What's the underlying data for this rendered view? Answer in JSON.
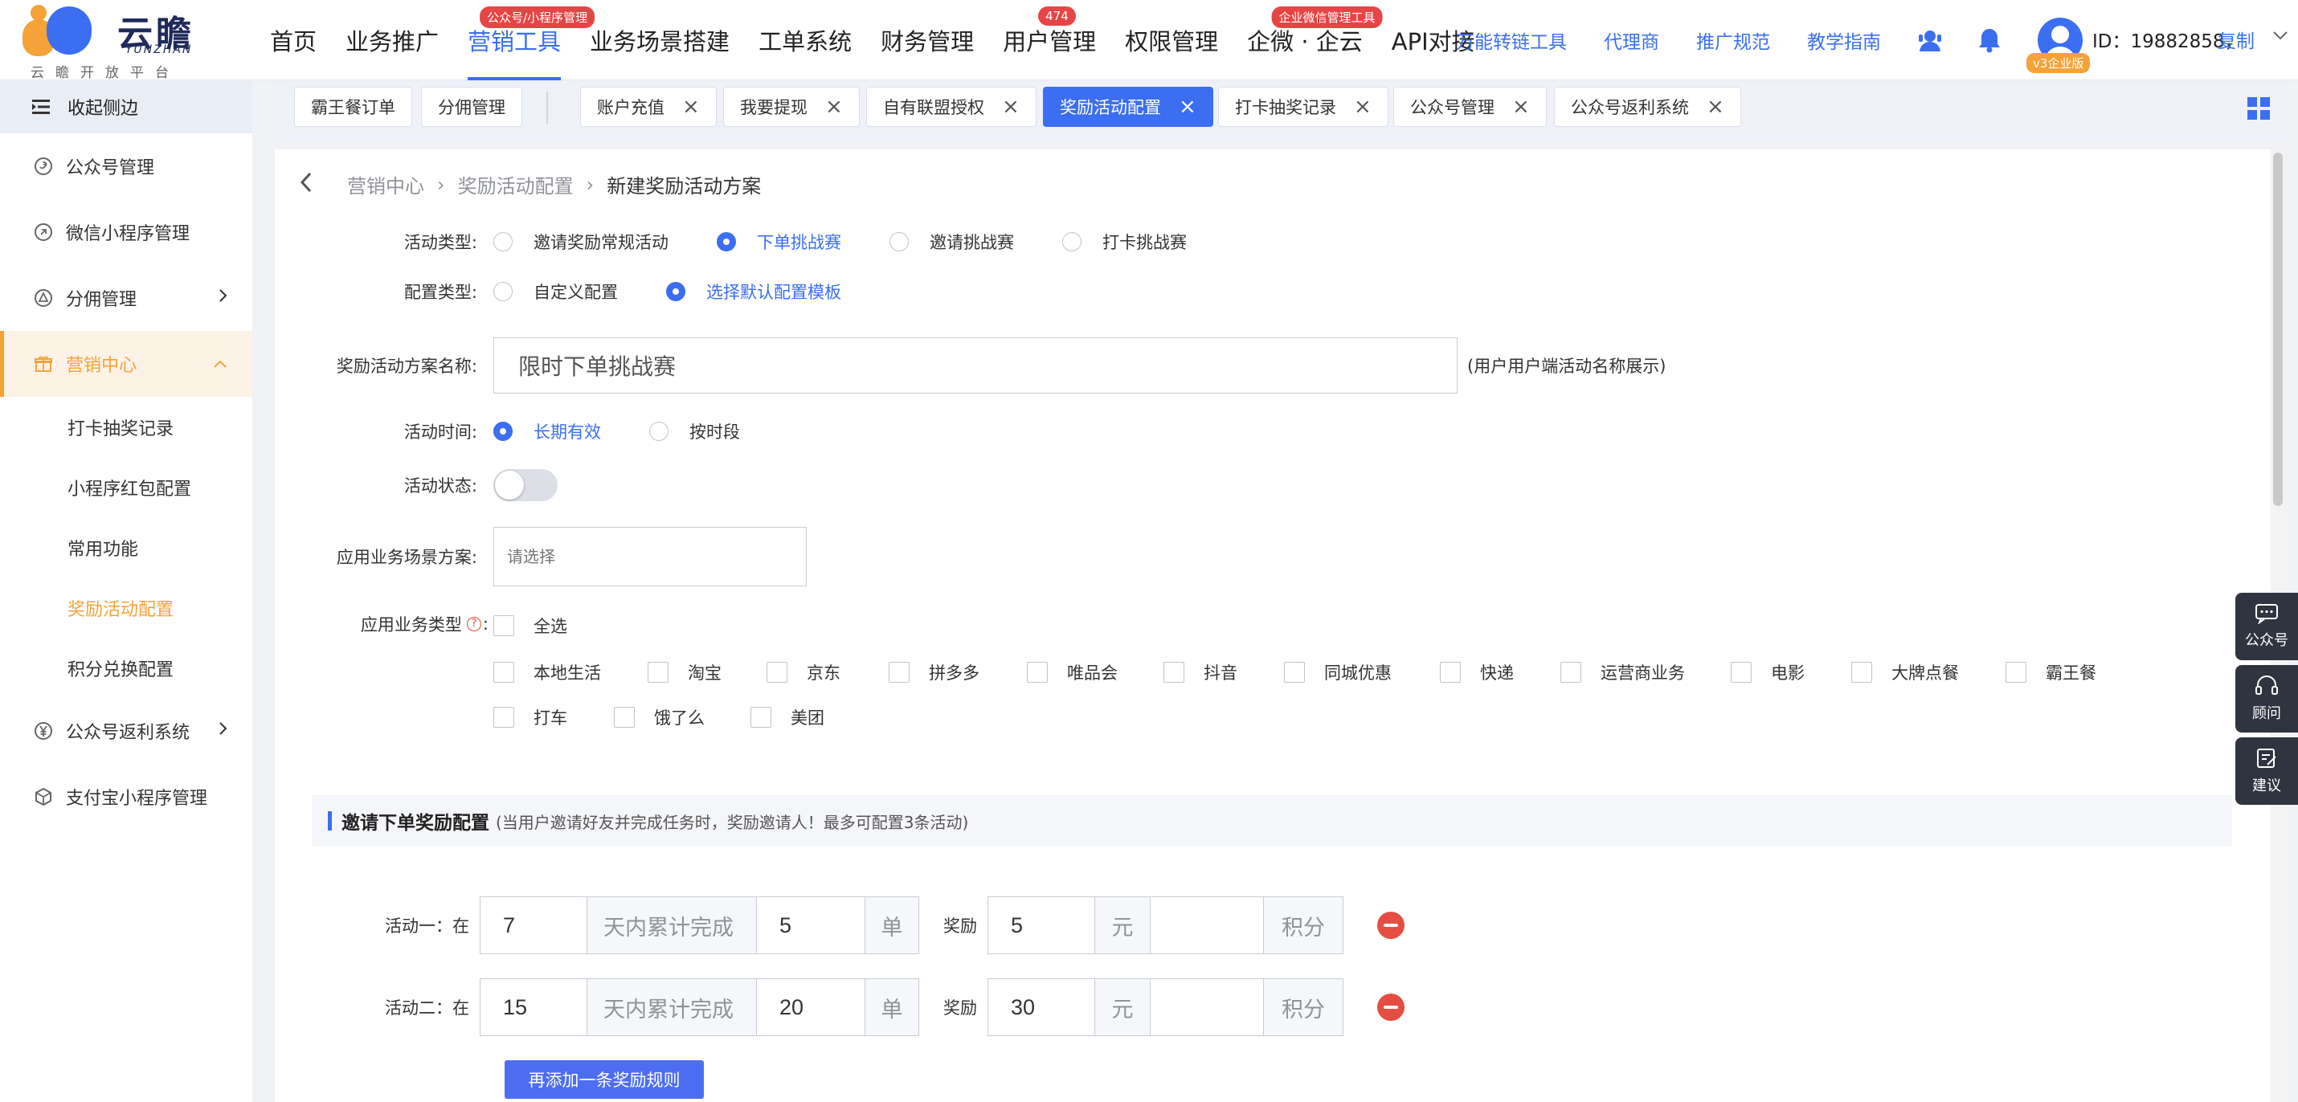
{
  "brand": {
    "name": "云瞻",
    "name_en": "YUNZHAN",
    "slogan": "云瞻开放平台"
  },
  "nav": [
    {
      "label": "首页",
      "badge": ""
    },
    {
      "label": "业务推广",
      "badge": ""
    },
    {
      "label": "营销工具",
      "badge": "公众号/小程序管理",
      "active": true
    },
    {
      "label": "业务场景搭建",
      "badge": ""
    },
    {
      "label": "工单系统",
      "badge": ""
    },
    {
      "label": "财务管理",
      "badge": ""
    },
    {
      "label": "用户管理",
      "badge": "474"
    },
    {
      "label": "权限管理",
      "badge": ""
    },
    {
      "label": "企微 · 企云",
      "badge": "企业微信管理工具"
    },
    {
      "label": "API对接",
      "badge": ""
    }
  ],
  "links": [
    "万能转链工具",
    "代理商",
    "推广规范",
    "教学指南"
  ],
  "user": {
    "id_text": "ID：19882858，",
    "copy": "复制",
    "vip": "v3企业版"
  },
  "sidebar": {
    "collapse": "收起侧边",
    "items": [
      {
        "label": "公众号管理"
      },
      {
        "label": "微信小程序管理"
      },
      {
        "label": "分佣管理"
      },
      {
        "label": "营销中心"
      }
    ],
    "subs": [
      "打卡抽奖记录",
      "小程序红包配置",
      "常用功能",
      "奖励活动配置",
      "积分兑换配置"
    ],
    "bottom": [
      {
        "label": "公众号返利系统"
      },
      {
        "label": "支付宝小程序管理"
      }
    ]
  },
  "tabs": [
    "霸王餐订单",
    "分佣管理",
    "账户充值",
    "我要提现",
    "自有联盟授权",
    "奖励活动配置",
    "打卡抽奖记录",
    "公众号管理",
    "公众号返利系统"
  ],
  "breadcrumb": [
    "营销中心",
    "奖励活动配置",
    "新建奖励活动方案"
  ],
  "form": {
    "activity_type_label": "活动类型:",
    "activity_types": [
      "邀请奖励常规活动",
      "下单挑战赛",
      "邀请挑战赛",
      "打卡挑战赛"
    ],
    "config_type_label": "配置类型:",
    "config_types": [
      "自定义配置",
      "选择默认配置模板"
    ],
    "name_label": "奖励活动方案名称:",
    "name_value": "限时下单挑战赛",
    "name_hint": "(用户用户端活动名称展示)",
    "time_label": "活动时间:",
    "time_options": [
      "长期有效",
      "按时段"
    ],
    "status_label": "活动状态:",
    "scene_label": "应用业务场景方案:",
    "scene_placeholder": "请选择",
    "biz_label": "应用业务类型",
    "biz_colon": ":",
    "select_all": "全选",
    "biz_types": [
      "本地生活",
      "淘宝",
      "京东",
      "拼多多",
      "唯品会",
      "抖音",
      "同城优惠",
      "快递",
      "运营商业务",
      "电影",
      "大牌点餐",
      "霸王餐",
      "打车",
      "饿了么",
      "美团"
    ]
  },
  "section": {
    "title": "邀请下单奖励配置",
    "desc": "(当用户邀请好友并完成任务时，奖励邀请人！最多可配置3条活动)"
  },
  "activities": [
    {
      "label": "活动一：在",
      "days": "7",
      "days_unit": "天内累计完成",
      "orders": "5",
      "orders_unit": "单",
      "reward_label": "奖励",
      "yuan": "5",
      "yuan_unit": "元",
      "points": "",
      "points_unit": "积分"
    },
    {
      "label": "活动二：在",
      "days": "15",
      "days_unit": "天内累计完成",
      "orders": "20",
      "orders_unit": "单",
      "reward_label": "奖励",
      "yuan": "30",
      "yuan_unit": "元",
      "points": "",
      "points_unit": "积分"
    }
  ],
  "add_rule": "再添加一条奖励规则",
  "float": [
    "公众号",
    "顾问",
    "建议"
  ],
  "colors": {
    "accent": "#3b6ef0",
    "orange": "#f5a238",
    "danger": "#e54d42"
  }
}
